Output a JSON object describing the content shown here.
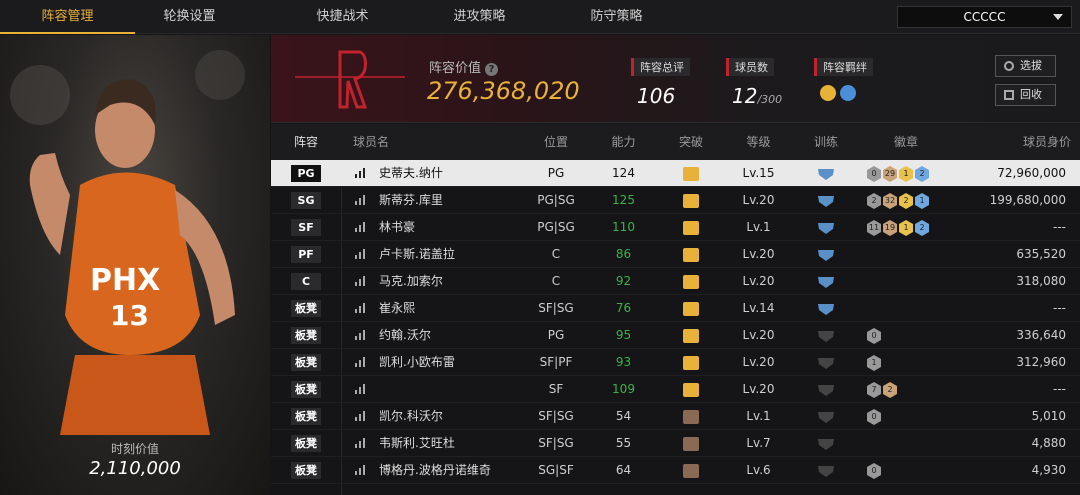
{
  "tabs": [
    {
      "label": "阵容管理",
      "active": true
    },
    {
      "label": "轮换设置"
    },
    {
      "label": "快捷战术"
    },
    {
      "label": "进攻策略"
    },
    {
      "label": "防守策略"
    }
  ],
  "account": {
    "name": "CCCCC"
  },
  "left_panel": {
    "value_label": "时刻价值",
    "value": "2,110,000"
  },
  "header": {
    "lineup_value_label": "阵容价值",
    "lineup_value": "276,368,020",
    "stats": [
      {
        "label": "阵容总评",
        "value": "106"
      },
      {
        "label": "球员数",
        "value": "12",
        "sub": "/300"
      },
      {
        "label": "阵容羁绊"
      }
    ],
    "buttons": {
      "filter": "选拔",
      "recycle": "回收"
    }
  },
  "table": {
    "headers": [
      "阵容",
      "球员名",
      "位置",
      "能力",
      "突破",
      "等级",
      "训练",
      "徽章",
      "球员身价"
    ],
    "rows": [
      {
        "slot": "PG",
        "name": "史蒂夫.纳什",
        "pos": "PG",
        "ability": "124",
        "level": "Lv.15",
        "price": "72,960,000",
        "selected": true,
        "badges": [
          "0",
          "29",
          "1",
          "2"
        ]
      },
      {
        "slot": "SG",
        "name": "斯蒂芬.库里",
        "pos": "PG|SG",
        "ability": "125",
        "level": "Lv.20",
        "price": "199,680,000",
        "green": true,
        "badges": [
          "2",
          "32",
          "2",
          "1"
        ]
      },
      {
        "slot": "SF",
        "name": "林书豪",
        "pos": "PG|SG",
        "ability": "110",
        "level": "Lv.1",
        "price": "---",
        "green": true,
        "badges": [
          "11",
          "19",
          "1",
          "2"
        ]
      },
      {
        "slot": "PF",
        "name": "卢卡斯.诺盖拉",
        "pos": "C",
        "ability": "86",
        "level": "Lv.20",
        "price": "635,520",
        "green": true,
        "badges": []
      },
      {
        "slot": "C",
        "name": "马克.加索尔",
        "pos": "C",
        "ability": "92",
        "level": "Lv.20",
        "price": "318,080",
        "green": true,
        "badges": []
      },
      {
        "slot": "板凳",
        "name": "崔永熙",
        "pos": "SF|SG",
        "ability": "76",
        "level": "Lv.14",
        "price": "---",
        "green": true,
        "badges": []
      },
      {
        "slot": "板凳",
        "name": "约翰.沃尔",
        "pos": "PG",
        "ability": "95",
        "level": "Lv.20",
        "price": "336,640",
        "green": true,
        "badges": [
          "0"
        ]
      },
      {
        "slot": "板凳",
        "name": "凯利.小欧布雷",
        "pos": "SF|PF",
        "ability": "93",
        "level": "Lv.20",
        "price": "312,960",
        "green": true,
        "badges": [
          "1"
        ]
      },
      {
        "slot": "板凳",
        "name": "",
        "pos": "SF",
        "ability": "109",
        "level": "Lv.20",
        "price": "---",
        "green": true,
        "badges": [
          "7",
          "2"
        ]
      },
      {
        "slot": "板凳",
        "name": "凯尔.科沃尔",
        "pos": "SF|SG",
        "ability": "54",
        "level": "Lv.1",
        "price": "5,010",
        "badges": [
          "0"
        ]
      },
      {
        "slot": "板凳",
        "name": "韦斯利.艾旺杜",
        "pos": "SF|SG",
        "ability": "55",
        "level": "Lv.7",
        "price": "4,880",
        "badges": []
      },
      {
        "slot": "板凳",
        "name": "博格丹.波格丹诺维奇",
        "pos": "SG|SF",
        "ability": "64",
        "level": "Lv.6",
        "price": "4,930",
        "badges": [
          "0"
        ]
      }
    ]
  },
  "colors": {
    "accent": "#e8b13a",
    "green": "#3cb34a",
    "red": "#c0222e"
  }
}
